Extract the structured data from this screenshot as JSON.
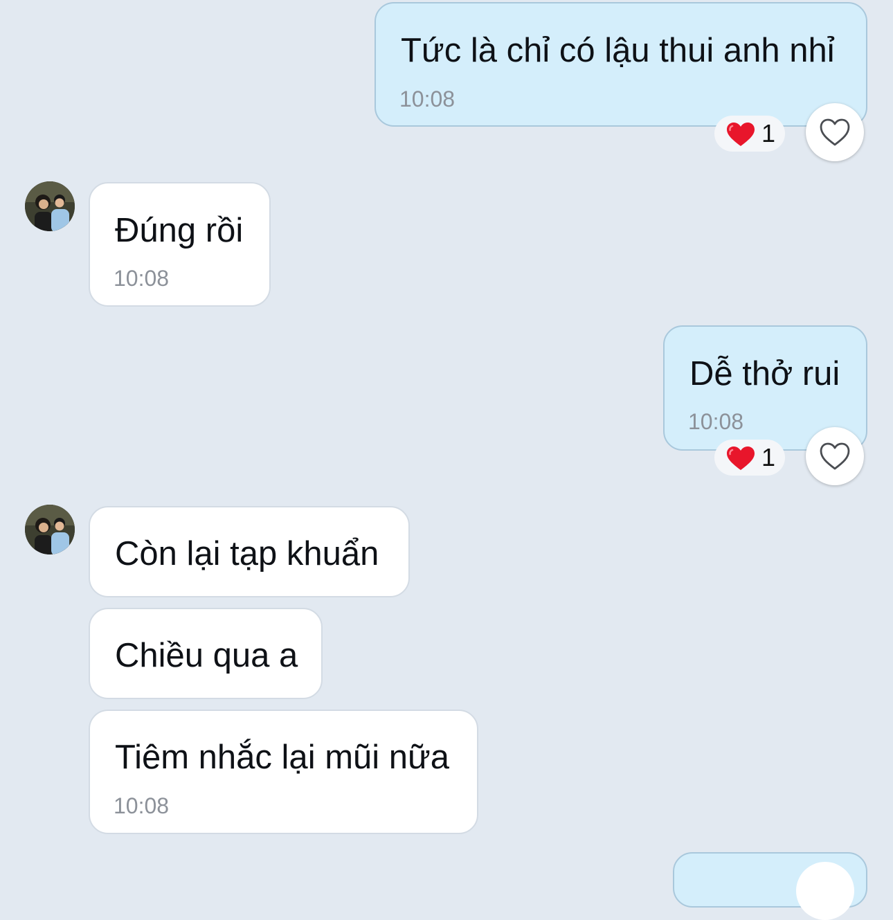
{
  "messages": [
    {
      "id": "m1",
      "direction": "out",
      "text": "Tức là chỉ có lậu thui anh nhỉ",
      "time": "10:08",
      "reaction": {
        "emoji": "heart",
        "count": "1"
      }
    },
    {
      "id": "m2",
      "direction": "in",
      "text": "Đúng rồi",
      "time": "10:08"
    },
    {
      "id": "m3",
      "direction": "out",
      "text": "Dễ thở rui",
      "time": "10:08",
      "reaction": {
        "emoji": "heart",
        "count": "1"
      }
    },
    {
      "id": "m4",
      "direction": "in",
      "text": "Còn lại tạp khuẩn"
    },
    {
      "id": "m5",
      "direction": "in",
      "text": "Chiều qua a"
    },
    {
      "id": "m6",
      "direction": "in",
      "text": "Tiêm nhắc lại mũi nữa",
      "time": "10:08"
    }
  ],
  "colors": {
    "background": "#e2e9f1",
    "outgoing_bubble": "#d4eefb",
    "incoming_bubble": "#ffffff",
    "reaction_heart": "#e8162b"
  },
  "icons": {
    "reaction": "red-heart",
    "like": "heart-outline-icon",
    "avatar": "contact-photo"
  }
}
